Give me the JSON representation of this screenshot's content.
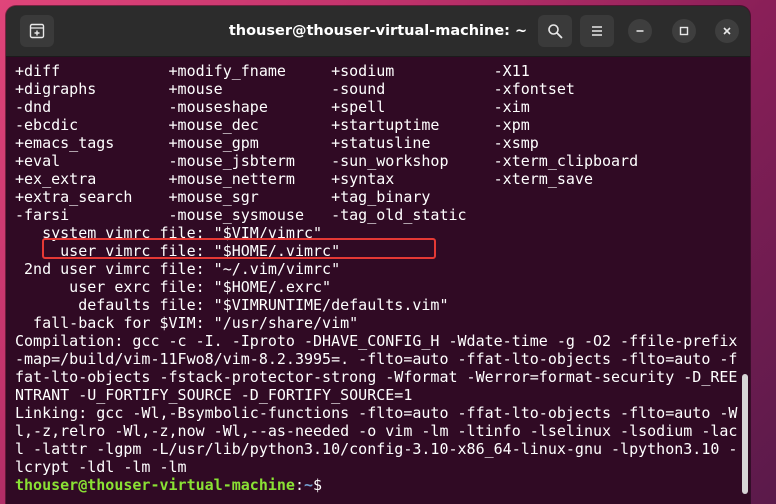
{
  "window": {
    "title": "thouser@thouser-virtual-machine: ~"
  },
  "icons": {
    "new_tab": "new-tab-icon",
    "search": "search-icon",
    "menu": "hamburger-menu-icon",
    "minimize": "minimize-icon",
    "maximize": "maximize-icon",
    "close": "close-icon"
  },
  "colors": {
    "terminal_bg": "#300a24",
    "titlebar_bg": "#2c2c2c",
    "prompt_user": "#8ae234",
    "prompt_path": "#729fcf",
    "highlight_box": "#e53935"
  },
  "terminal": {
    "lines": [
      "+diff            +modify_fname     +sodium           -X11",
      "+digraphs        +mouse            -sound            -xfontset",
      "-dnd             -mouseshape       +spell            -xim",
      "-ebcdic          +mouse_dec        +startuptime      -xpm",
      "+emacs_tags      +mouse_gpm        +statusline       -xsmp",
      "+eval            -mouse_jsbterm    -sun_workshop     -xterm_clipboard",
      "+ex_extra        +mouse_netterm    +syntax           -xterm_save",
      "+extra_search    +mouse_sgr        +tag_binary",
      "-farsi           -mouse_sysmouse   -tag_old_static",
      "   system vimrc file: \"$VIM/vimrc\"",
      "     user vimrc file: \"$HOME/.vimrc\"",
      " 2nd user vimrc file: \"~/.vim/vimrc\"",
      "      user exrc file: \"$HOME/.exrc\"",
      "       defaults file: \"$VIMRUNTIME/defaults.vim\"",
      "  fall-back for $VIM: \"/usr/share/vim\"",
      "Compilation: gcc -c -I. -Iproto -DHAVE_CONFIG_H -Wdate-time -g -O2 -ffile-prefix",
      "-map=/build/vim-11Fwo8/vim-8.2.3995=. -flto=auto -ffat-lto-objects -flto=auto -f",
      "fat-lto-objects -fstack-protector-strong -Wformat -Werror=format-security -D_REE",
      "NTRANT -U_FORTIFY_SOURCE -D_FORTIFY_SOURCE=1",
      "Linking: gcc -Wl,-Bsymbolic-functions -flto=auto -ffat-lto-objects -flto=auto -W",
      "l,-z,relro -Wl,-z,now -Wl,--as-needed -o vim -lm -ltinfo -lselinux -lsodium -lac",
      "l -lattr -lgpm -L/usr/lib/python3.10/config-3.10-x86_64-linux-gnu -lpython3.10 -",
      "lcrypt -ldl -lm -lm"
    ],
    "prompt": {
      "user_host": "thouser@thouser-virtual-machine",
      "separator": ":",
      "path": "~",
      "symbol": "$"
    }
  }
}
